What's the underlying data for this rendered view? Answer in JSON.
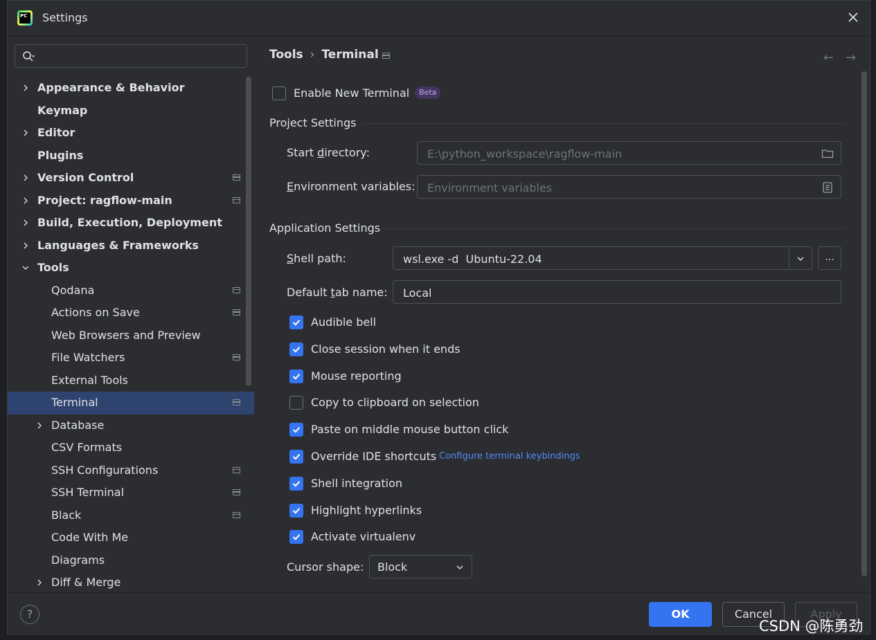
{
  "window": {
    "title": "Settings",
    "logo_text": "PC"
  },
  "search": {
    "placeholder": ""
  },
  "tree": {
    "items": [
      {
        "label": "Appearance & Behavior",
        "bold": true,
        "level": 0,
        "expandable": true,
        "expanded": false,
        "project_icon": false
      },
      {
        "label": "Keymap",
        "bold": true,
        "level": 0,
        "expandable": false,
        "project_icon": false
      },
      {
        "label": "Editor",
        "bold": true,
        "level": 0,
        "expandable": true,
        "expanded": false,
        "project_icon": false
      },
      {
        "label": "Plugins",
        "bold": true,
        "level": 0,
        "expandable": false,
        "project_icon": false
      },
      {
        "label": "Version Control",
        "bold": true,
        "level": 0,
        "expandable": true,
        "expanded": false,
        "project_icon": true
      },
      {
        "label": "Project: ragflow-main",
        "bold": true,
        "level": 0,
        "expandable": true,
        "expanded": false,
        "project_icon": true
      },
      {
        "label": "Build, Execution, Deployment",
        "bold": true,
        "level": 0,
        "expandable": true,
        "expanded": false,
        "project_icon": false
      },
      {
        "label": "Languages & Frameworks",
        "bold": true,
        "level": 0,
        "expandable": true,
        "expanded": false,
        "project_icon": false
      },
      {
        "label": "Tools",
        "bold": true,
        "level": 0,
        "expandable": true,
        "expanded": true,
        "project_icon": false
      },
      {
        "label": "Qodana",
        "bold": false,
        "level": 1,
        "expandable": false,
        "project_icon": true
      },
      {
        "label": "Actions on Save",
        "bold": false,
        "level": 1,
        "expandable": false,
        "project_icon": true
      },
      {
        "label": "Web Browsers and Preview",
        "bold": false,
        "level": 1,
        "expandable": false,
        "project_icon": false
      },
      {
        "label": "File Watchers",
        "bold": false,
        "level": 1,
        "expandable": false,
        "project_icon": true
      },
      {
        "label": "External Tools",
        "bold": false,
        "level": 1,
        "expandable": false,
        "project_icon": false
      },
      {
        "label": "Terminal",
        "bold": false,
        "level": 1,
        "expandable": false,
        "project_icon": true,
        "selected": true
      },
      {
        "label": "Database",
        "bold": false,
        "level": 1,
        "expandable": true,
        "expanded": false,
        "project_icon": false
      },
      {
        "label": "CSV Formats",
        "bold": false,
        "level": 1,
        "expandable": false,
        "project_icon": false
      },
      {
        "label": "SSH Configurations",
        "bold": false,
        "level": 1,
        "expandable": false,
        "project_icon": true
      },
      {
        "label": "SSH Terminal",
        "bold": false,
        "level": 1,
        "expandable": false,
        "project_icon": true
      },
      {
        "label": "Black",
        "bold": false,
        "level": 1,
        "expandable": false,
        "project_icon": true
      },
      {
        "label": "Code With Me",
        "bold": false,
        "level": 1,
        "expandable": false,
        "project_icon": false
      },
      {
        "label": "Diagrams",
        "bold": false,
        "level": 1,
        "expandable": false,
        "project_icon": false
      },
      {
        "label": "Diff & Merge",
        "bold": false,
        "level": 1,
        "expandable": true,
        "expanded": false,
        "project_icon": false
      }
    ]
  },
  "breadcrumb": {
    "parent": "Tools",
    "separator": "›",
    "current": "Terminal"
  },
  "nav": {
    "back_icon": "←",
    "forward_icon": "→"
  },
  "enable_new_terminal": {
    "label": "Enable New Terminal",
    "checked": false,
    "badge": "Beta"
  },
  "project_settings": {
    "title": "Project Settings",
    "start_directory": {
      "label_pre": "Start ",
      "label_u": "d",
      "label_post": "irectory:",
      "value": "E:\\python_workspace\\ragflow-main",
      "icon": "folder-icon"
    },
    "env_vars": {
      "label_u": "E",
      "label_post": "nvironment variables:",
      "placeholder": "Environment variables",
      "icon": "document-icon"
    }
  },
  "application_settings": {
    "title": "Application Settings",
    "shell_path": {
      "label_u": "S",
      "label_post": "hell path:",
      "value": "wsl.exe -d  Ubuntu-22.04",
      "browse_label": "..."
    },
    "default_tab": {
      "label_pre": "Default ",
      "label_u": "t",
      "label_post": "ab name:",
      "value": "Local"
    },
    "options": [
      {
        "label": "Audible bell",
        "checked": true
      },
      {
        "label": "Close session when it ends",
        "checked": true
      },
      {
        "label": "Mouse reporting",
        "checked": true
      },
      {
        "label": "Copy to clipboard on selection",
        "checked": false
      },
      {
        "label": "Paste on middle mouse button click",
        "checked": true
      },
      {
        "label": "Override IDE shortcuts",
        "checked": true
      },
      {
        "label": "Shell integration",
        "checked": true
      },
      {
        "label": "Highlight hyperlinks",
        "checked": true
      },
      {
        "label": "Activate virtualenv",
        "checked": true
      }
    ],
    "configure_link": "Configure terminal keybindings",
    "cursor_shape": {
      "label": "Cursor shape:",
      "value": "Block"
    }
  },
  "footer": {
    "help": "?",
    "ok": "OK",
    "cancel": "Cancel",
    "apply": "Apply"
  },
  "watermark": "CSDN @陈勇劲",
  "colors": {
    "accent": "#3574f0",
    "selected_bg": "#2e436e",
    "link": "#548af7",
    "panel_bg": "#2b2d30"
  }
}
